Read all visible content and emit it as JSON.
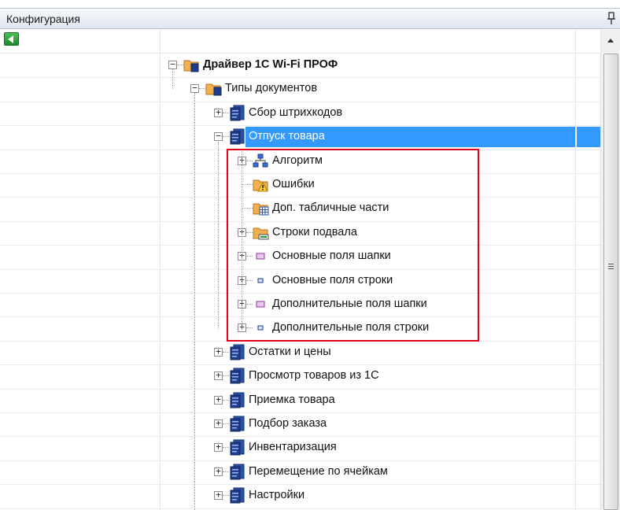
{
  "panel": {
    "title": "Конфигурация"
  },
  "tree": {
    "root": {
      "label": "Драйвер 1С Wi-Fi ПРОФ"
    },
    "doc_types": {
      "label": "Типы документов"
    },
    "items": [
      {
        "key": "sbor",
        "label": "Сбор штрихкодов"
      },
      {
        "key": "otpusk",
        "label": "Отпуск товара",
        "selected": true
      },
      {
        "key": "ostatki",
        "label": "Остатки и цены"
      },
      {
        "key": "prosmotr",
        "label": "Просмотр товаров из 1С"
      },
      {
        "key": "priemka",
        "label": "Приемка товара"
      },
      {
        "key": "podbor",
        "label": "Подбор заказа"
      },
      {
        "key": "invent",
        "label": "Инвентаризация"
      },
      {
        "key": "peremesh",
        "label": "Перемещение по ячейкам"
      },
      {
        "key": "nastroiki",
        "label": "Настройки"
      }
    ],
    "otpusk_children": [
      {
        "key": "algoritm",
        "label": "Алгоритм",
        "icon": "algorithm-icon"
      },
      {
        "key": "oshibki",
        "label": "Ошибки",
        "icon": "errors-icon"
      },
      {
        "key": "dop_tab",
        "label": "Доп. табличные части",
        "icon": "table-parts-icon"
      },
      {
        "key": "stroki_podvala",
        "label": "Строки подвала",
        "icon": "footer-rows-icon"
      },
      {
        "key": "osn_shapki",
        "label": "Основные поля шапки",
        "icon": "header-field-icon"
      },
      {
        "key": "osn_stroki",
        "label": "Основные поля строки",
        "icon": "row-field-icon"
      },
      {
        "key": "dop_shapki",
        "label": "Дополнительные поля шапки",
        "icon": "header-field-icon"
      },
      {
        "key": "dop_stroki",
        "label": "Дополнительные поля строки",
        "icon": "row-field-icon"
      }
    ]
  },
  "colors": {
    "selection": "#3399ff",
    "highlight_frame": "#e0001a",
    "doc_icon": "#1f3e8a",
    "folder_icon": "#e8a040"
  }
}
